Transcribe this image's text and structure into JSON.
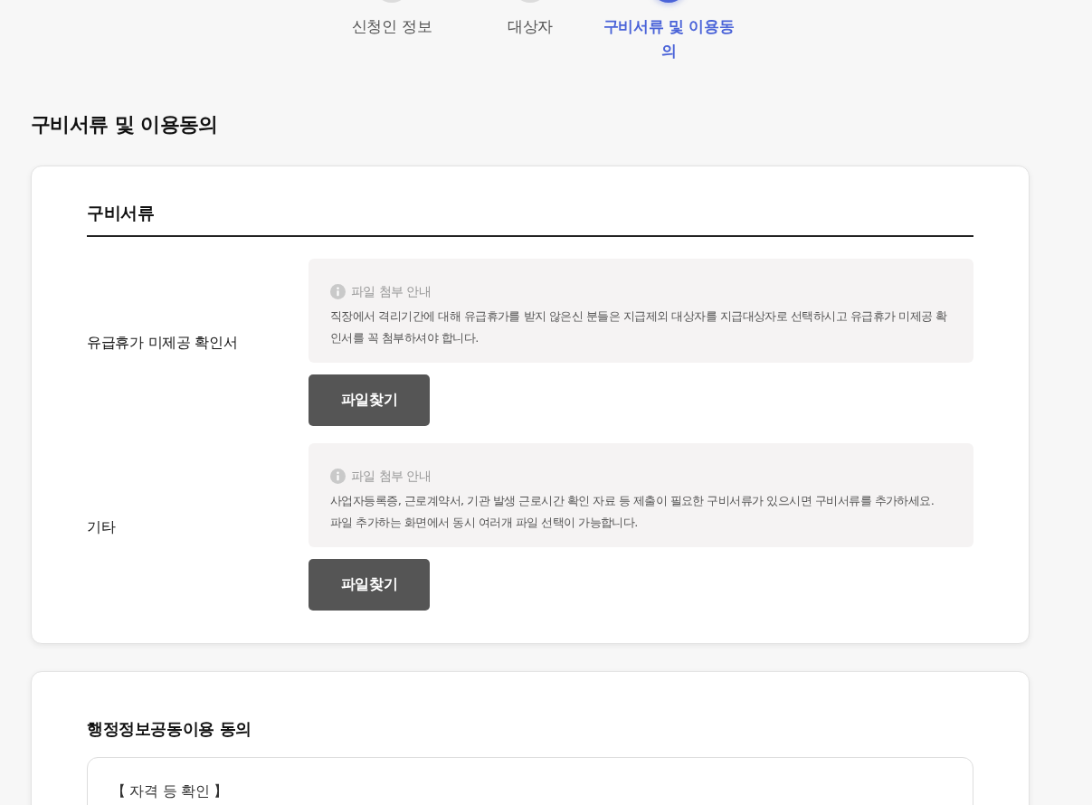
{
  "steps": [
    {
      "label": "신청인 정보",
      "selected": false
    },
    {
      "label": "대상자",
      "selected": false
    },
    {
      "label": "구비서류 및 이용동의",
      "selected": true
    }
  ],
  "page_title": "구비서류 및 이용동의",
  "documents": {
    "title": "구비서류",
    "rows": [
      {
        "label": "유급휴가 미제공 확인서",
        "notice": {
          "title": "파일 첨부 안내",
          "paragraphs": [
            "직장에서 격리기간에 대해 유급휴가를 받지 않은신 분들은 지급제외 대상자를 지급대상자로 선택하시고 유급휴가 미제공 확인서를 꼭 첨부하셔야 합니다."
          ]
        },
        "button": "파일찾기"
      },
      {
        "label": "기타",
        "notice": {
          "title": "파일 첨부 안내",
          "paragraphs": [
            "사업자등록증, 근로계약서, 기관 발생 근로시간 확인 자료 등 제출이 필요한 구비서류가 있으시면 구비서류를 추가하세요.",
            "파일 추가하는 화면에서 동시 여러개 파일 선택이 가능합니다."
          ]
        },
        "button": "파일찾기"
      }
    ]
  },
  "consent": {
    "title": "행정정보공동이용 동의",
    "box_title": "【 자격 등 확인 】"
  }
}
